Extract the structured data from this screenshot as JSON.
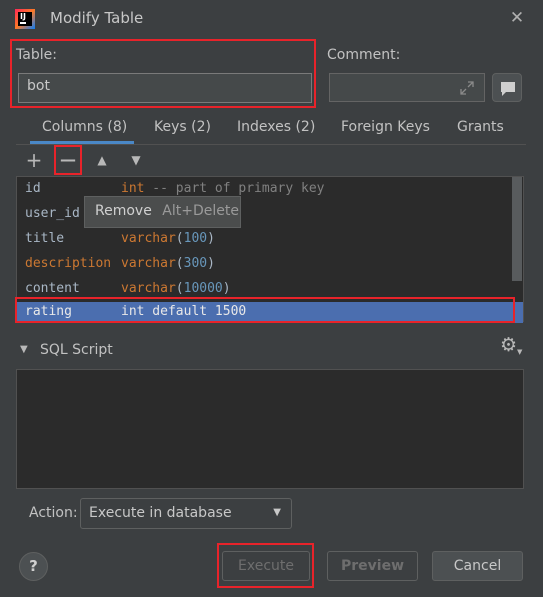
{
  "window": {
    "title": "Modify Table",
    "close_icon": "✕",
    "app_icon_text": "IJ"
  },
  "form": {
    "table_label": "Table:",
    "table_value": "bot",
    "comment_label": "Comment:",
    "comment_value": ""
  },
  "tabs": [
    {
      "label": "Columns (8)"
    },
    {
      "label": "Keys (2)"
    },
    {
      "label": "Indexes (2)"
    },
    {
      "label": "Foreign Keys"
    },
    {
      "label": "Grants"
    }
  ],
  "toolbar": {
    "add_icon": "+",
    "remove_icon": "—",
    "up_icon": "▲",
    "down_icon": "▼"
  },
  "columns": [
    {
      "name": "id",
      "type_kw": "int",
      "type_rest": " -- part of primary key",
      "name_color": "plain"
    },
    {
      "name": "user_id",
      "type_kw": "",
      "type_rest": "",
      "name_color": "plain"
    },
    {
      "name": "title",
      "type_kw": "varchar",
      "type_num": "100",
      "name_color": "plain"
    },
    {
      "name": "description",
      "type_kw": "varchar",
      "type_num": "300",
      "name_color": "kw"
    },
    {
      "name": "content",
      "type_kw": "varchar",
      "type_num": "10000",
      "name_color": "plain"
    },
    {
      "name": "rating",
      "type_full": "int default 1500",
      "selected": true
    }
  ],
  "tooltip": {
    "label": "Remove",
    "shortcut": "Alt+Delete"
  },
  "sql_script": {
    "label": "SQL Script",
    "expand_icon": "▼",
    "gear_icon": "⚙"
  },
  "action": {
    "label": "Action:",
    "selected": "Execute in database"
  },
  "buttons": {
    "help": "?",
    "execute": "Execute",
    "preview": "Preview",
    "cancel": "Cancel"
  },
  "colors": {
    "accent": "#4a88c7",
    "highlight_red": "#e8232a",
    "selected_row": "#4b6eaf",
    "keyword": "#cc7832",
    "number": "#6897bb"
  }
}
